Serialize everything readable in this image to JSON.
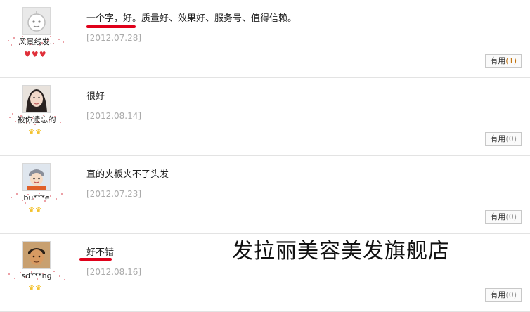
{
  "reviews": [
    {
      "nickname": "风景线发..",
      "comment": "一个字，好。质量好、效果好、服务号、值得信赖。",
      "date": "[2012.07.28]",
      "useful_label": "有用",
      "useful_count": "(1)",
      "rank_icon": "heart-gem-icon",
      "rank_count": 3,
      "avatar_icon": "default-avatar-icon"
    },
    {
      "nickname": "被你遗忘的",
      "comment": "很好",
      "date": "[2012.08.14]",
      "useful_label": "有用",
      "useful_count": "(0)",
      "rank_icon": "crown-icon",
      "rank_count": 2,
      "avatar_icon": "user-photo-icon"
    },
    {
      "nickname": "bu***e",
      "comment": "直的夹板夹不了头发",
      "date": "[2012.07.23]",
      "useful_label": "有用",
      "useful_count": "(0)",
      "rank_icon": "crown-icon",
      "rank_count": 2,
      "avatar_icon": "user-photo-icon"
    },
    {
      "nickname": "sd***ng",
      "comment": "好不错",
      "date": "[2012.08.16]",
      "useful_label": "有用",
      "useful_count": "(0)",
      "rank_icon": "crown-icon",
      "rank_count": 2,
      "avatar_icon": "user-photo-icon"
    }
  ],
  "watermark": "发拉丽美容美发旗舰店",
  "colors": {
    "underline": "#e0001a",
    "date": "#aaaaaa",
    "divider": "#e3e3e3"
  }
}
